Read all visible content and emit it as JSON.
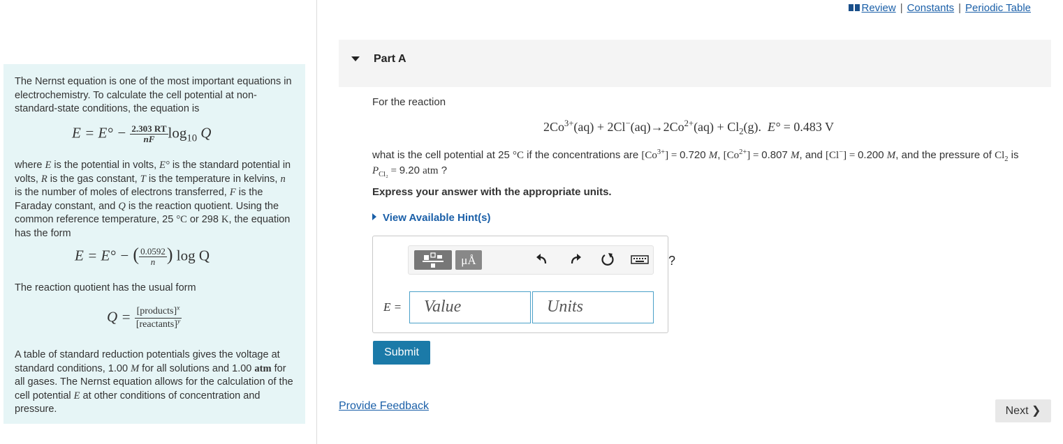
{
  "top_links": {
    "review": "Review",
    "constants": "Constants",
    "periodic_table": "Periodic Table",
    "separator": "|"
  },
  "info": {
    "para1": "The Nernst equation is one of the most important equations in electrochemistry. To calculate the cell potential at non-standard-state conditions, the equation is",
    "eq1": {
      "lhs": "E = E° −",
      "num": "2.303 RT",
      "den": "nF",
      "rest": "log",
      "sub": "10",
      "q": "Q"
    },
    "para2": {
      "t1": "where ",
      "v1": "E",
      "t2": " is the potential in volts, ",
      "v2": "E°",
      "t3": " is the standard potential in volts, ",
      "v3": "R",
      "t4": " is the gas constant, ",
      "v4": "T",
      "t5": " is the temperature in kelvins, ",
      "v5": "n",
      "t6": " is the number of moles of electrons transferred, ",
      "v6": "F",
      "t7": " is the Faraday constant, and ",
      "v7": "Q",
      "t8": " is the reaction quotient. Using the common reference temperature, 25 ",
      "v8": "°C",
      "t9": " or 298 ",
      "v9": "K",
      "t10": ", the equation has the form"
    },
    "eq2": {
      "lhs": "E = E° −",
      "num": "0.0592",
      "den": "n",
      "rest": "log Q"
    },
    "para3": "The reaction quotient has the usual form",
    "eq3": {
      "lhs": "Q =",
      "num": "[products]",
      "num_exp": "x",
      "den": "[reactants]",
      "den_exp": "y"
    },
    "para4": {
      "t1": "A table of standard reduction potentials gives the voltage at standard conditions, 1.00 ",
      "v1": "M",
      "t2": " for all solutions and 1.00 ",
      "v2": "atm",
      "t3": " for all gases. The Nernst equation allows for the calculation of the cell potential ",
      "v3": "E",
      "t4": " at other conditions of concentration and pressure."
    }
  },
  "part": {
    "title": "Part A"
  },
  "prompt": "For the reaction",
  "reaction": {
    "co": "2Co",
    "co_charge": "3+",
    "aq1": "(aq) + 2Cl",
    "cl_charge": "−",
    "aq2": "(aq)→2Co",
    "co2_charge": "2+",
    "aq3": "(aq) + Cl",
    "cl2_sub": "2",
    "g": "(g).",
    "e0": "E°",
    "e0_val": " = 0.483 V"
  },
  "question": {
    "t1": "what is the cell potential at 25 ",
    "deg": "°C",
    "t2": " if the concentrations are ",
    "c1": "[Co",
    "c1_charge": "3+",
    "c1_end": "] = ",
    "v1": "0.720",
    "u1": "M",
    "sep1": ", ",
    "c2": "[Co",
    "c2_charge": "2+",
    "c2_end": "] = ",
    "v2": "0.807",
    "u2": "M",
    "sep2": ", and ",
    "c3": "[Cl",
    "c3_charge": "−",
    "c3_end": "] = ",
    "v3": "0.200",
    "u3": "M",
    "t3": ", and the pressure of ",
    "cl": "Cl",
    "cl_sub": "2",
    "t4": " is ",
    "p": "P",
    "p_sub": "Cl₂",
    "p_eq": " = ",
    "p_val": "9.20",
    "p_unit": "atm",
    "t5": " ?"
  },
  "express": "Express your answer with the appropriate units.",
  "hint": "View Available Hint(s)",
  "answer": {
    "label": "E =",
    "units_button": "μÅ",
    "value_placeholder": "Value",
    "units_placeholder": "Units",
    "help": "?"
  },
  "submit": "Submit",
  "feedback": "Provide Feedback",
  "next": "Next ❯"
}
